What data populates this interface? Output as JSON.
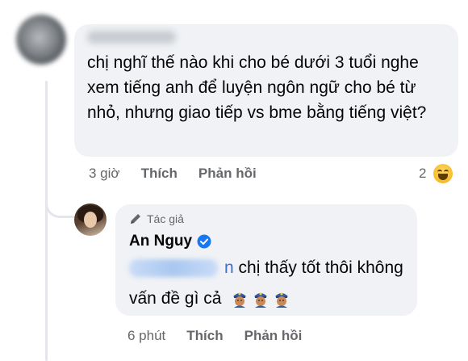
{
  "comment": {
    "text": "chị nghĩ thế nào khi cho bé dưới 3 tuổi nghe xem tiếng anh để luyện ngôn ngữ cho bé từ nhỏ, nhưng giao tiếp vs bme bằng tiếng việt?",
    "time": "3 giờ",
    "like_label": "Thích",
    "reply_label": "Phản hồi",
    "reaction_count": "2",
    "reaction_icon": "laughing-emoji-icon"
  },
  "reply": {
    "author_tag": "Tác giả",
    "author_name": "An Nguy",
    "mention_tail": "n",
    "text_line1": "chị thấy tốt thôi không",
    "text_line2": "vấn đề gì cả",
    "emojis": [
      "police-officer-emoji-icon",
      "police-officer-emoji-icon",
      "police-officer-emoji-icon"
    ],
    "time": "6 phút",
    "like_label": "Thích",
    "reply_label": "Phản hồi"
  },
  "colors": {
    "bubble": "#f0f2f5",
    "meta_text": "#65676b",
    "verified": "#1877f2",
    "mention": "#3b6fd6"
  }
}
